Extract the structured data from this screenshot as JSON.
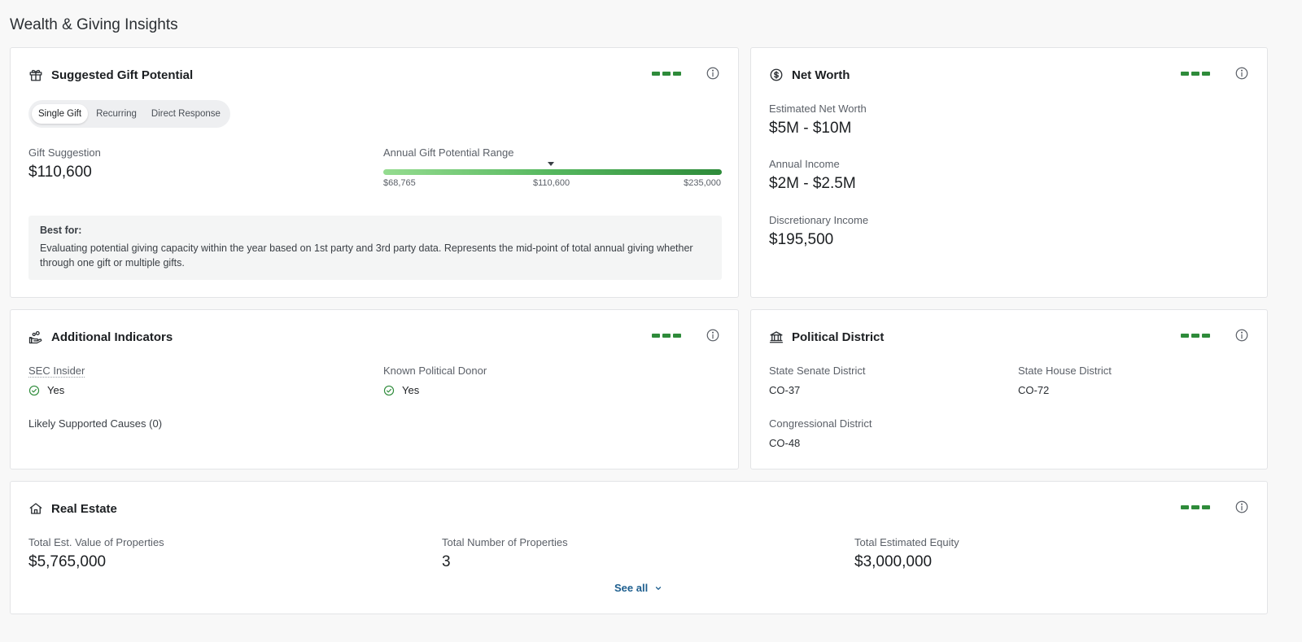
{
  "page": {
    "title": "Wealth & Giving Insights"
  },
  "gift": {
    "title": "Suggested Gift Potential",
    "tabs": [
      "Single Gift",
      "Recurring",
      "Direct Response"
    ],
    "active_tab": "Single Gift",
    "suggestion_label": "Gift Suggestion",
    "suggestion_value": "$110,600",
    "range_label": "Annual Gift Potential Range",
    "range_min": "$68,765",
    "range_mid": "$110,600",
    "range_max": "$235,000",
    "best_for_title": "Best for:",
    "best_for_text": "Evaluating potential giving capacity within the year based on 1st party and 3rd party data. Represents the mid-point of total annual giving whether through one gift or multiple gifts."
  },
  "net_worth": {
    "title": "Net Worth",
    "estimated_label": "Estimated Net Worth",
    "estimated_value": "$5M - $10M",
    "income_label": "Annual Income",
    "income_value": "$2M - $2.5M",
    "discretionary_label": "Discretionary Income",
    "discretionary_value": "$195,500"
  },
  "indicators": {
    "title": "Additional Indicators",
    "sec_label": "SEC Insider",
    "sec_value": "Yes",
    "donor_label": "Known Political Donor",
    "donor_value": "Yes",
    "causes_label": "Likely Supported Causes (0)"
  },
  "political": {
    "title": "Political District",
    "senate_label": "State Senate District",
    "senate_value": "CO-37",
    "house_label": "State House District",
    "house_value": "CO-72",
    "congress_label": "Congressional District",
    "congress_value": "CO-48"
  },
  "real_estate": {
    "title": "Real Estate",
    "value_label": "Total Est. Value of Properties",
    "value_value": "$5,765,000",
    "count_label": "Total Number of Properties",
    "count_value": "3",
    "equity_label": "Total Estimated Equity",
    "equity_value": "$3,000,000",
    "see_all": "See all"
  },
  "colors": {
    "confidence": "#2e8b3a",
    "link": "#1e5f8f",
    "check": "#2e8b3a"
  },
  "icons": [
    "gift-icon",
    "dollar-circle-icon",
    "hand-coins-icon",
    "bank-icon",
    "home-icon",
    "info-icon",
    "check-circle-icon",
    "chevron-down-icon"
  ]
}
